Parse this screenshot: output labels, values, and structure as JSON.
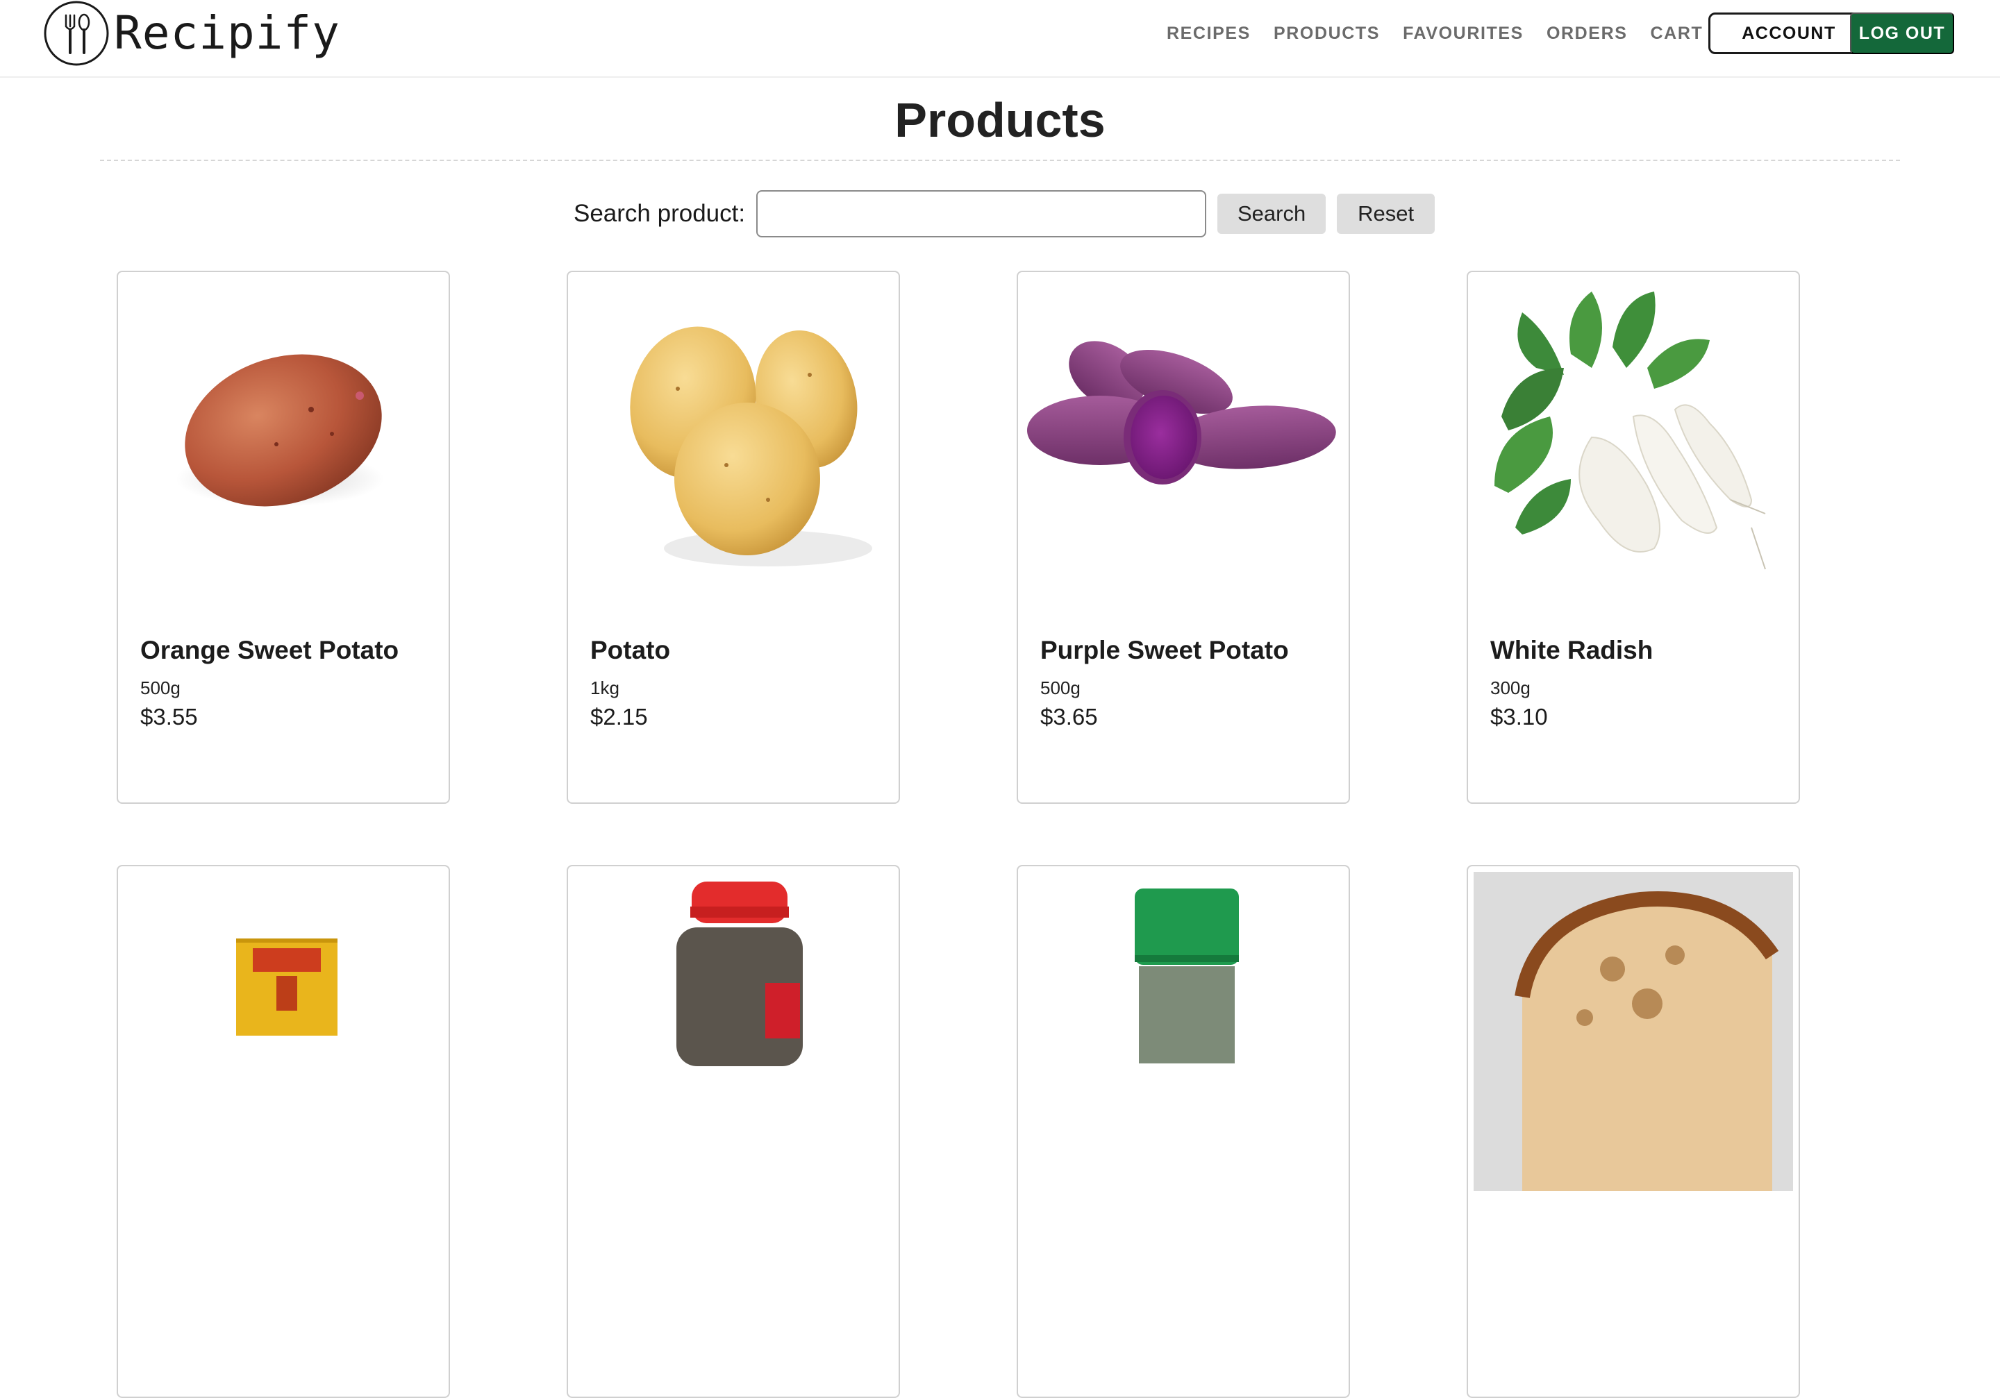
{
  "header": {
    "brand": "Recipify",
    "nav": [
      "RECIPES",
      "PRODUCTS",
      "FAVOURITES",
      "ORDERS",
      "CART"
    ],
    "account_label": "ACCOUNT",
    "logout_label": "LOG OUT",
    "accent_color": "#14683a"
  },
  "page": {
    "title": "Products"
  },
  "search": {
    "label": "Search product:",
    "value": "",
    "placeholder": "",
    "search_label": "Search",
    "reset_label": "Reset"
  },
  "products": [
    {
      "name": "Orange Sweet Potato",
      "size": "500g",
      "price": "$3.55",
      "image": "orange-sweet-potato-image"
    },
    {
      "name": "Potato",
      "size": "1kg",
      "price": "$2.15",
      "image": "potato-image"
    },
    {
      "name": "Purple Sweet Potato",
      "size": "500g",
      "price": "$3.65",
      "image": "purple-sweet-potato-image"
    },
    {
      "name": "White Radish",
      "size": "300g",
      "price": "$3.10",
      "image": "white-radish-image"
    },
    {
      "name": "",
      "size": "",
      "price": "",
      "image": "yellow-spice-box-image"
    },
    {
      "name": "",
      "size": "",
      "price": "",
      "image": "pepper-shaker-image"
    },
    {
      "name": "",
      "size": "",
      "price": "",
      "image": "green-herb-jar-image"
    },
    {
      "name": "",
      "size": "",
      "price": "",
      "image": "sourdough-bread-image"
    }
  ]
}
